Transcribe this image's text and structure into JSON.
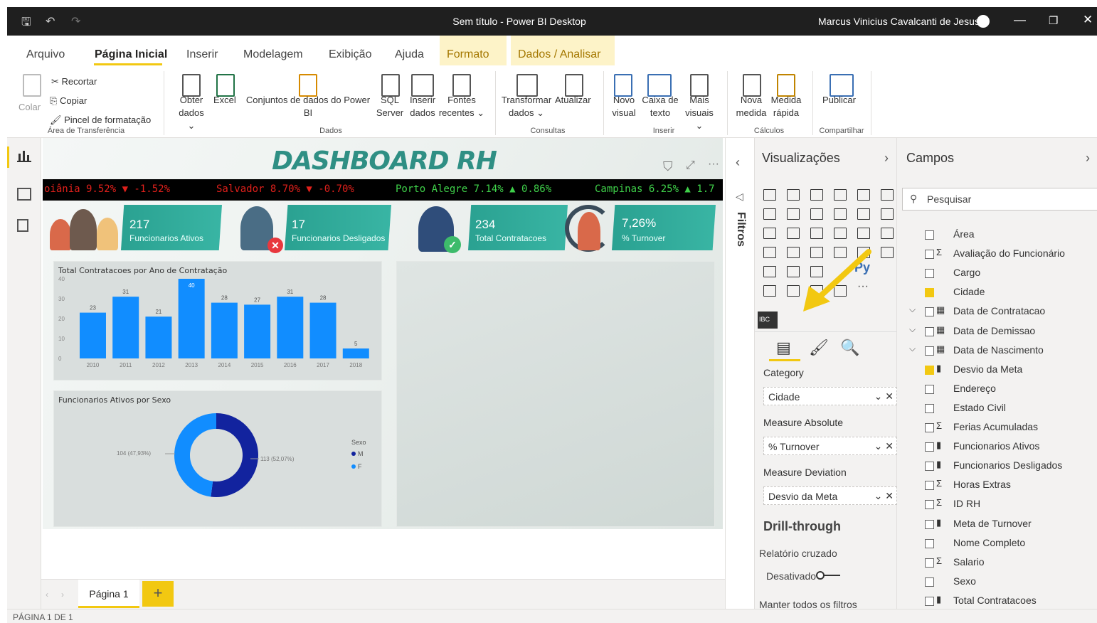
{
  "window": {
    "title": "Sem título - Power BI Desktop",
    "user": "Marcus Vinicius Cavalcanti de Jesus"
  },
  "menu_tabs": [
    "Arquivo",
    "Página Inicial",
    "Inserir",
    "Modelagem",
    "Exibição",
    "Ajuda"
  ],
  "context_tabs": [
    "Formato",
    "Dados / Analisar"
  ],
  "ribbon": {
    "paste": "Colar",
    "cut": "Recortar",
    "copy": "Copiar",
    "format_painter": "Pincel de formatação",
    "group_clipboard": "Área de Transferência",
    "get_data": [
      "Obter",
      "dados ⌄"
    ],
    "excel": "Excel",
    "datasets": [
      "Conjuntos de dados do Power",
      "BI"
    ],
    "sql": [
      "SQL",
      "Server"
    ],
    "enter_data": [
      "Inserir",
      "dados"
    ],
    "recent": [
      "Fontes",
      "recentes ⌄"
    ],
    "group_data": "Dados",
    "transform": [
      "Transformar",
      "dados ⌄"
    ],
    "refresh": "Atualizar",
    "group_queries": "Consultas",
    "new_visual": [
      "Novo",
      "visual"
    ],
    "text_box": [
      "Caixa de",
      "texto"
    ],
    "more_visuals": [
      "Mais",
      "visuais ⌄"
    ],
    "group_insert": "Inserir",
    "new_measure": [
      "Nova",
      "medida"
    ],
    "quick_measure": [
      "Medida",
      "rápida"
    ],
    "group_calc": "Cálculos",
    "publish": "Publicar",
    "group_share": "Compartilhar"
  },
  "dashboard": {
    "title": "DASHBOARD RH",
    "ticker": [
      {
        "text": "oiânia 9.52% ▼ -1.52%",
        "color": "#e0201b"
      },
      {
        "text": "Salvador 8.70% ▼ -0.70%",
        "color": "#e0201b"
      },
      {
        "text": "Porto Alegre 7.14% ▲ 0.86%",
        "color": "#3fd14a"
      },
      {
        "text": "Campinas 6.25% ▲ 1.7",
        "color": "#3fd14a"
      }
    ],
    "kpis": [
      {
        "value": "217",
        "label": "Funcionarios Ativos"
      },
      {
        "value": "17",
        "label": "Funcionarios Desligados"
      },
      {
        "value": "234",
        "label": "Total Contratacoes"
      },
      {
        "value": "7,26%",
        "label": "% Turnover"
      }
    ]
  },
  "chart_data": [
    {
      "type": "bar",
      "title": "Total Contratacoes por Ano de Contratação",
      "categories": [
        "2010",
        "2011",
        "2012",
        "2013",
        "2014",
        "2015",
        "2016",
        "2017",
        "2018"
      ],
      "values": [
        23,
        31,
        21,
        40,
        28,
        27,
        31,
        28,
        5
      ],
      "ylim": [
        0,
        40
      ],
      "yticks": [
        "0",
        "10",
        "20",
        "30",
        "40"
      ],
      "color": "#118dff"
    },
    {
      "type": "pie",
      "title": "Funcionarios Ativos por Sexo",
      "legend_title": "Sexo",
      "slices": [
        {
          "name": "M",
          "value": 113,
          "label": "113 (52,07%)",
          "color": "#12239e"
        },
        {
          "name": "F",
          "value": 104,
          "label": "104 (47,93%)",
          "color": "#118dff"
        }
      ]
    }
  ],
  "page_tabs": {
    "page": "Página 1",
    "add": "+"
  },
  "status": "PÁGINA 1 DE 1",
  "filters_label": "Filtros",
  "viz_pane": {
    "title": "Visualizações",
    "category_label": "Category",
    "category_value": "Cidade",
    "measure_abs_label": "Measure Absolute",
    "measure_abs_value": "% Turnover",
    "measure_dev_label": "Measure Deviation",
    "measure_dev_value": "Desvio da Meta",
    "drill": "Drill-through",
    "cross": "Relatório cruzado",
    "cross_state": "Desativado",
    "keep": "Manter todos os filtros",
    "py": "Py",
    "more": "···",
    "custom": "IBC"
  },
  "fields_pane": {
    "title": "Campos",
    "search": "Pesquisar",
    "fields": [
      {
        "name": "Área",
        "sym": "",
        "checked": false,
        "expand": false
      },
      {
        "name": "Avaliação do Funcionário",
        "sym": "Σ",
        "checked": false,
        "expand": false
      },
      {
        "name": "Cargo",
        "sym": "",
        "checked": false,
        "expand": false
      },
      {
        "name": "Cidade",
        "sym": "",
        "checked": true,
        "expand": false
      },
      {
        "name": "Data de Contratacao",
        "sym": "▦",
        "checked": false,
        "expand": true
      },
      {
        "name": "Data de Demissao",
        "sym": "▦",
        "checked": false,
        "expand": true
      },
      {
        "name": "Data de Nascimento",
        "sym": "▦",
        "checked": false,
        "expand": true
      },
      {
        "name": "Desvio da Meta",
        "sym": "▮",
        "checked": true,
        "expand": false
      },
      {
        "name": "Endereço",
        "sym": "",
        "checked": false,
        "expand": false
      },
      {
        "name": "Estado Civil",
        "sym": "",
        "checked": false,
        "expand": false
      },
      {
        "name": "Ferias Acumuladas",
        "sym": "Σ",
        "checked": false,
        "expand": false
      },
      {
        "name": "Funcionarios Ativos",
        "sym": "▮",
        "checked": false,
        "expand": false
      },
      {
        "name": "Funcionarios Desligados",
        "sym": "▮",
        "checked": false,
        "expand": false
      },
      {
        "name": "Horas Extras",
        "sym": "Σ",
        "checked": false,
        "expand": false
      },
      {
        "name": "ID RH",
        "sym": "Σ",
        "checked": false,
        "expand": false
      },
      {
        "name": "Meta de Turnover",
        "sym": "▮",
        "checked": false,
        "expand": false
      },
      {
        "name": "Nome Completo",
        "sym": "",
        "checked": false,
        "expand": false
      },
      {
        "name": "Salario",
        "sym": "Σ",
        "checked": false,
        "expand": false
      },
      {
        "name": "Sexo",
        "sym": "",
        "checked": false,
        "expand": false
      },
      {
        "name": "Total Contratacoes",
        "sym": "▮",
        "checked": false,
        "expand": false
      }
    ]
  }
}
